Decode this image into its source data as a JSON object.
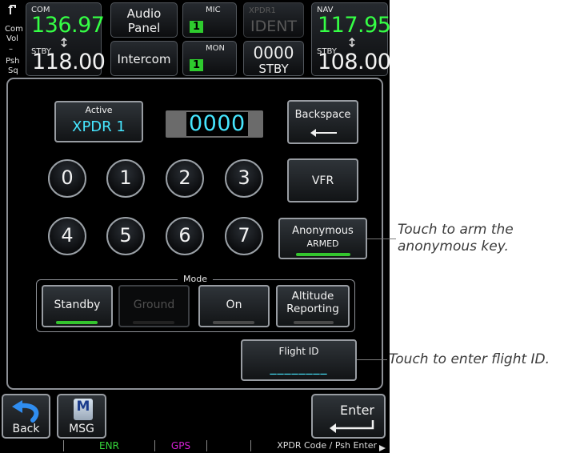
{
  "com": {
    "label": "COM",
    "active": "136.97",
    "standby_label": "STBY",
    "standby": "118.00",
    "side_labels": [
      "Com",
      "Vol",
      "–",
      "Psh",
      "Sq"
    ]
  },
  "audio": {
    "panel_label": "Audio\nPanel",
    "intercom_label": "Intercom"
  },
  "mic": {
    "label": "MIC",
    "value": "1"
  },
  "mon": {
    "label": "MON",
    "value": "1"
  },
  "xpdr_top": {
    "label": "XPDR1",
    "ident": "IDENT",
    "code": "0000",
    "mode": "STBY"
  },
  "nav": {
    "label": "NAV",
    "active": "117.95",
    "standby_label": "STBY",
    "standby": "108.00"
  },
  "active_button": {
    "label": "Active",
    "value": "XPDR 1"
  },
  "code_display": "0000",
  "backspace_label": "Backspace",
  "keys": [
    "0",
    "1",
    "2",
    "3",
    "4",
    "5",
    "6",
    "7"
  ],
  "vfr_label": "VFR",
  "anonymous": {
    "label": "Anonymous",
    "state": "ARMED"
  },
  "mode": {
    "title": "Mode",
    "buttons": [
      {
        "label": "Standby",
        "active": true,
        "enabled": true
      },
      {
        "label": "Ground",
        "active": false,
        "enabled": false
      },
      {
        "label": "On",
        "active": false,
        "enabled": true
      },
      {
        "label": "Altitude\nReporting",
        "active": false,
        "enabled": true
      }
    ]
  },
  "flight_id": {
    "label": "Flight ID",
    "value": "________"
  },
  "bottom": {
    "back_label": "Back",
    "msg_label": "MSG",
    "msg_icon_letter": "M",
    "enter_label": "Enter"
  },
  "status_bar": {
    "enr": "ENR",
    "gps": "GPS",
    "hint": "XPDR Code / Psh Enter"
  },
  "callouts": {
    "anonymous": "Touch to arm the\nanonymous key.",
    "flight_id": "Touch to enter flight ID."
  },
  "colors": {
    "accent_green": "#35ff45",
    "cyan": "#46e6ff",
    "magenta": "#d020d0",
    "indicator_green": "#34c52e"
  }
}
